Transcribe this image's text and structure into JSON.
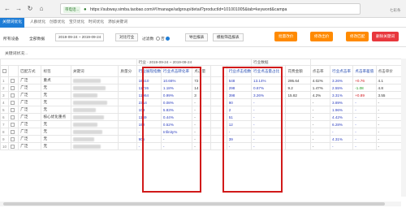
{
  "browser": {
    "nav": {
      "back": "←",
      "forward": "→",
      "reload": "↻",
      "home": "⌂"
    },
    "security_badge": "带电话...",
    "url": "https://subway.simba.taobao.com/#!/manage/adgroup/detail?productId=101001005&tab=keyword&campa",
    "right_label": "七彩条"
  },
  "app_tabs": [
    "关键词优化",
    "人群优化",
    "创意优化",
    "宝贝优化",
    "时间优化",
    "添加关键词"
  ],
  "toolbar": {
    "device_label": "所有设备",
    "data_source": "全部数据",
    "date_range": "2019-09-24 ~ 2019-09-24",
    "compare_button": "对比行业",
    "filter_label": "过滤数",
    "filter_opt_on": "否",
    "filter_opt_off": "",
    "export_button": "导出报表",
    "hide_button": "模板筛选报表",
    "actions": [
      "批量改价",
      "修改出价",
      "修改匹配",
      "删除关键词"
    ]
  },
  "subbar": {
    "text": "关键词状况..."
  },
  "table": {
    "group_date_left": "行业 - 2019-09-24 ~ 2019-09-24",
    "group_date_mid": "行业数据",
    "columns": [
      "",
      "",
      "匹配方式",
      "标签",
      "关键词",
      "质量分",
      "行业展现指数",
      "行业点击转化率",
      "点击量",
      "",
      "行业点击指数",
      "行业点击量占比",
      "花费金额",
      "点击率",
      "行业点击率",
      "点击率差值",
      "点击单价"
    ],
    "rows": [
      {
        "n": "1",
        "match": "广泛",
        "tag": "重点",
        "c1": "16610",
        "c2": "10.66%",
        "c3": "72",
        "c4": "",
        "c5": "548",
        "c6": "13.14%",
        "c7": "295.64",
        "c8": "4.02%",
        "c9": "3.26%",
        "c10": "+0.76",
        "c11": "4.1"
      },
      {
        "n": "2",
        "match": "广泛",
        "tag": "无",
        "c1": "11726",
        "c2": "1.18%",
        "c3": "14",
        "c4": "",
        "c5": "298",
        "c6": "0.67%",
        "c7": "9.2",
        "c8": "1.47%",
        "c9": "2.55%",
        "c10": "-1.08",
        "c11": "4.8"
      },
      {
        "n": "3",
        "match": "广泛",
        "tag": "无",
        "c1": "11964",
        "c2": "0.99%",
        "c3": "3",
        "c4": "",
        "c5": "398",
        "c6": "3.26%",
        "c7": "15.82",
        "c8": "4.2%",
        "c9": "3.31%",
        "c10": "+0.89",
        "c11": "3.55"
      },
      {
        "n": "4",
        "match": "广泛",
        "tag": "无",
        "c1": "2314",
        "c2": "0.08%",
        "c3": "-",
        "c4": "",
        "c5": "90",
        "c6": "-",
        "c7": "",
        "c8": "-",
        "c9": "3.89%",
        "c10": "-",
        "c11": "-"
      },
      {
        "n": "5",
        "match": "广泛",
        "tag": "无",
        "c1": "103",
        "c2": "5.83%",
        "c3": "-",
        "c4": "",
        "c5": "2",
        "c6": "-",
        "c7": "",
        "c8": "-",
        "c9": "1.96%",
        "c10": "-",
        "c11": "-"
      },
      {
        "n": "6",
        "match": "广泛",
        "tag": "核心优化重点",
        "c1": "1149",
        "c2": "0.44%",
        "c3": "-",
        "c4": "",
        "c5": "51",
        "c6": "-",
        "c7": "",
        "c8": "-",
        "c9": "4.42%",
        "c10": "-",
        "c11": "-"
      },
      {
        "n": "7",
        "match": "广泛",
        "tag": "无",
        "c1": "192",
        "c2": "0.52%",
        "c3": "-",
        "c4": "",
        "c5": "12",
        "c6": "-",
        "c7": "",
        "c8": "-",
        "c9": "6.28%",
        "c10": "-",
        "c11": "-"
      },
      {
        "n": "8",
        "match": "广泛",
        "tag": "无",
        "c1": "-",
        "c2": "Infinity%",
        "c3": "-",
        "c4": "",
        "c5": "-",
        "c6": "-",
        "c7": "",
        "c8": "-",
        "c9": "-",
        "c10": "-",
        "c11": "-"
      },
      {
        "n": "9",
        "match": "广泛",
        "tag": "无",
        "c1": "905",
        "c2": "-",
        "c3": "-",
        "c4": "",
        "c5": "39",
        "c6": "-",
        "c7": "",
        "c8": "-",
        "c9": "4.31%",
        "c10": "-",
        "c11": "-"
      },
      {
        "n": "10",
        "match": "广泛",
        "tag": "无",
        "c1": "-",
        "c2": "-",
        "c3": "-",
        "c4": "",
        "c5": "-",
        "c6": "-",
        "c7": "",
        "c8": "-",
        "c9": "-",
        "c10": "-",
        "c11": "-"
      }
    ]
  },
  "colors": {
    "accent": "#1e7dd6",
    "orange": "#ff8a00",
    "red": "#e8383d",
    "highlight": "#d11a1a",
    "value_blue": "#2d3fbf"
  }
}
